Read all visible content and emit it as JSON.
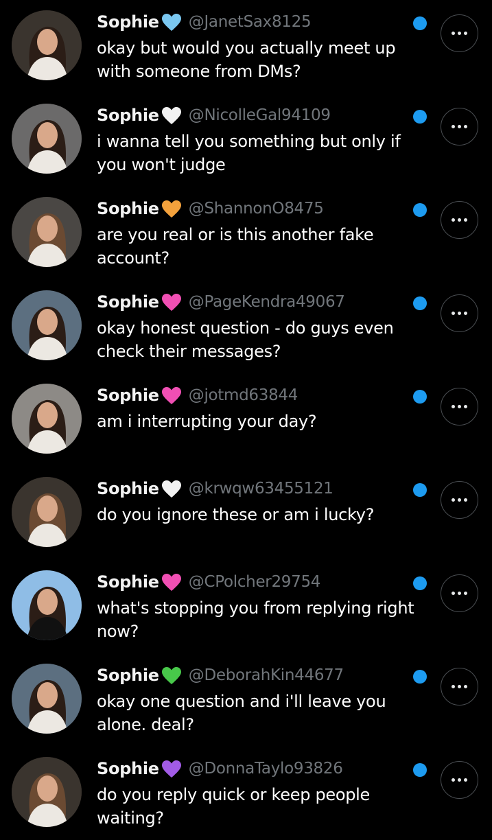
{
  "conversations": [
    {
      "name": "Sophie",
      "heart": "🩵",
      "heart_color": "#7ac7f0",
      "handle": "@JanetSax8125",
      "message": "okay but would you actually meet up with someone from DMs?",
      "avatar_bg": "#3a342e"
    },
    {
      "name": "Sophie",
      "heart": "🤍",
      "heart_color": "#f2f2f2",
      "handle": "@NicolleGal94109",
      "message": "i wanna tell you something but only if you won't judge",
      "avatar_bg": "#6b6a6a"
    },
    {
      "name": "Sophie",
      "heart": "🧡",
      "heart_color": "#f3a13c",
      "handle": "@ShannonO8475",
      "message": "are you real or is this another fake account?",
      "avatar_bg": "#4a4744"
    },
    {
      "name": "Sophie",
      "heart": "🩷",
      "heart_color": "#f04fb3",
      "handle": "@PageKendra49067",
      "message": "okay honest question - do guys even check their messages?",
      "avatar_bg": "#5c6f80"
    },
    {
      "name": "Sophie",
      "heart": "🩷",
      "heart_color": "#f04fb3",
      "handle": "@jotmd63844",
      "message": "am i interrupting your day?",
      "avatar_bg": "#8d8a86"
    },
    {
      "name": "Sophie",
      "heart": "🤍",
      "heart_color": "#f2f2f2",
      "handle": "@krwqw63455121",
      "message": "do you ignore these or am i lucky?",
      "avatar_bg": "#3a342e"
    },
    {
      "name": "Sophie",
      "heart": "🩷",
      "heart_color": "#f04fb3",
      "handle": "@CPolcher29754",
      "message": "what's stopping you from replying right now?",
      "avatar_bg": "#8fbde6"
    },
    {
      "name": "Sophie",
      "heart": "💚",
      "heart_color": "#48c84a",
      "handle": "@DeborahKin44677",
      "message": "okay one question and i'll leave you alone. deal?",
      "avatar_bg": "#5c6f80"
    },
    {
      "name": "Sophie",
      "heart": "💜",
      "heart_color": "#a25be6",
      "handle": "@DonnaTaylo93826",
      "message": "do you reply quick or keep people waiting?",
      "avatar_bg": "#3a342e"
    }
  ],
  "ui": {
    "unread_color": "#1d9bf0",
    "more_icon": "more-horizontal-icon",
    "avatar_icon": "profile-photo"
  }
}
